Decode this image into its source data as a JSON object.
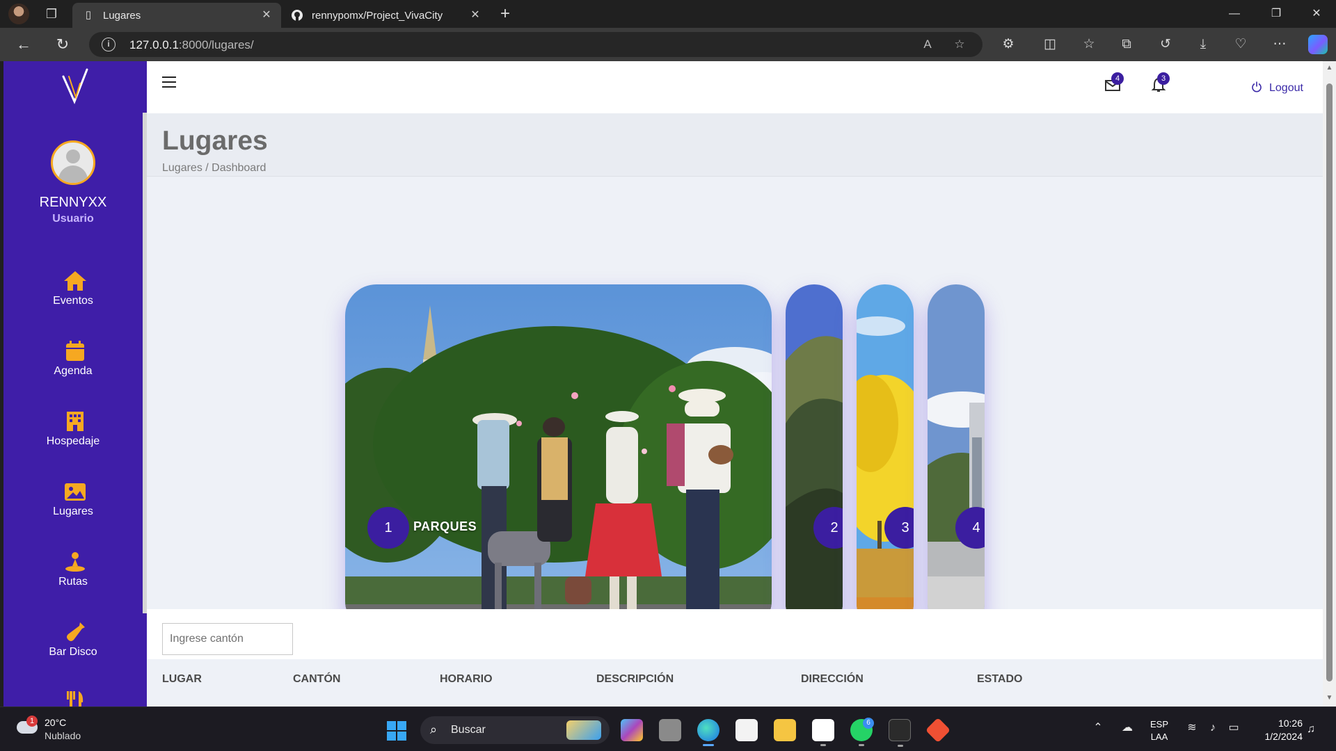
{
  "browser": {
    "tabs": [
      {
        "label": "Lugares",
        "active": true
      },
      {
        "label": "rennypomx/Project_VivaCity",
        "active": false
      }
    ],
    "url_host": "127.0.0.1",
    "url_path": ":8000/lugares/",
    "tab_close_glyph": "✕",
    "new_tab_glyph": "+"
  },
  "sidebar": {
    "user_name": "RENNYXX",
    "user_role": "Usuario",
    "items": [
      {
        "label": "Eventos",
        "icon": "home-icon"
      },
      {
        "label": "Agenda",
        "icon": "calendar-icon"
      },
      {
        "label": "Hospedaje",
        "icon": "building-icon"
      },
      {
        "label": "Lugares",
        "icon": "image-icon"
      },
      {
        "label": "Rutas",
        "icon": "route-pin-icon"
      },
      {
        "label": "Bar Disco",
        "icon": "bottle-icon"
      },
      {
        "label": "",
        "icon": "utensils-icon"
      }
    ],
    "accent_color": "#3f1ea8",
    "icon_color": "#f6a821"
  },
  "header": {
    "messages_count": "4",
    "notifications_count": "3",
    "logout_label": "Logout"
  },
  "page": {
    "title": "Lugares",
    "breadcrumb": "Lugares / Dashboard"
  },
  "gallery": {
    "cards": [
      {
        "number": "1",
        "caption": "PARQUES",
        "expanded": true
      },
      {
        "number": "2",
        "caption": "",
        "expanded": false
      },
      {
        "number": "3",
        "caption": "",
        "expanded": false
      },
      {
        "number": "4",
        "caption": "",
        "expanded": false
      }
    ]
  },
  "filter": {
    "placeholder": "Ingrese cantón",
    "value": ""
  },
  "table": {
    "columns": [
      "LUGAR",
      "CANTÓN",
      "HORARIO",
      "DESCRIPCIÓN",
      "DIRECCIÓN",
      "ESTADO"
    ]
  },
  "taskbar": {
    "temperature": "20°C",
    "weather": "Nublado",
    "weather_badge": "1",
    "search_label": "Buscar",
    "whatsapp_badge": "6",
    "language": "ESP",
    "keyboard": "LAA",
    "time": "10:26",
    "date": "1/2/2024"
  }
}
